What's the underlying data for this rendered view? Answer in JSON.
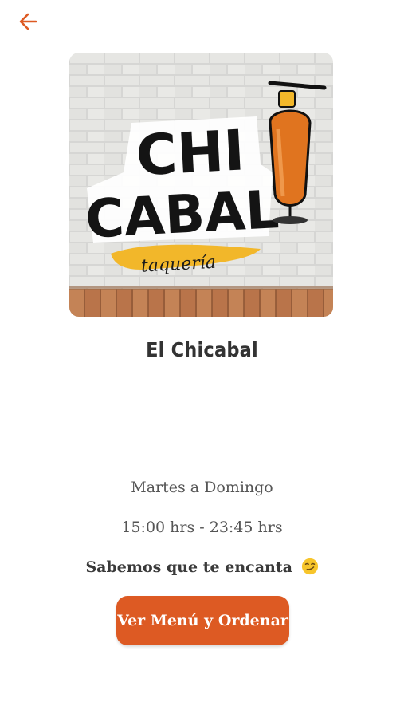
{
  "header": {
    "back_icon": "arrow-left-icon",
    "accent_color": "#dd5a23"
  },
  "restaurant": {
    "logo": {
      "line1": "CHI",
      "line2": "CABAL",
      "tagline": "taquería"
    },
    "name": "El Chicabal",
    "schedule_days": "Martes a Domingo",
    "schedule_hours": "15:00 hrs - 23:45 hrs",
    "tagline": "Sabemos que te encanta",
    "tagline_emoji": "smirking-face-emoji"
  },
  "actions": {
    "order_label": "Ver Menú y Ordenar"
  }
}
